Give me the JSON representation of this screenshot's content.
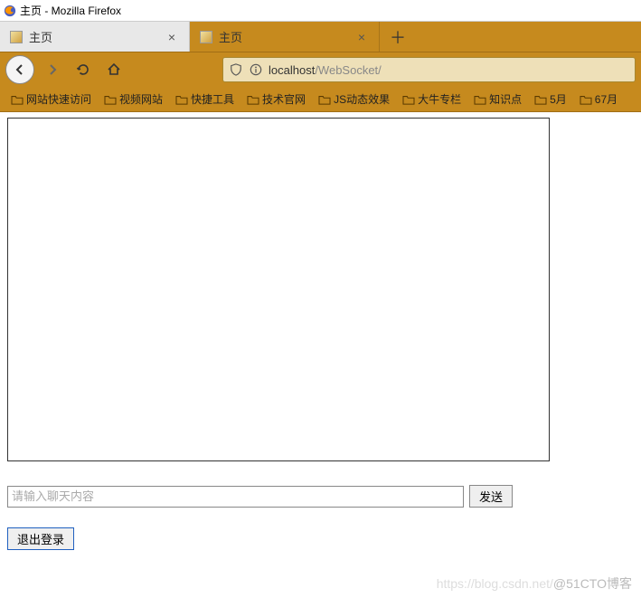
{
  "window": {
    "title": "主页 - Mozilla Firefox"
  },
  "tabs": [
    {
      "label": "主页",
      "active": false
    },
    {
      "label": "主页",
      "active": true
    }
  ],
  "url": {
    "host": "localhost",
    "path": "/WebSocket/"
  },
  "bookmarks": [
    {
      "label": "网站快速访问"
    },
    {
      "label": "视频网站"
    },
    {
      "label": "快捷工具"
    },
    {
      "label": "技术官网"
    },
    {
      "label": "JS动态效果"
    },
    {
      "label": "大牛专栏"
    },
    {
      "label": "知识点"
    },
    {
      "label": "5月"
    },
    {
      "label": "67月"
    }
  ],
  "chat": {
    "placeholder": "请输入聊天内容",
    "send_label": "发送",
    "logout_label": "退出登录"
  },
  "watermark": {
    "left": "https://blog.csdn.net/",
    "right": "@51CTO博客"
  }
}
